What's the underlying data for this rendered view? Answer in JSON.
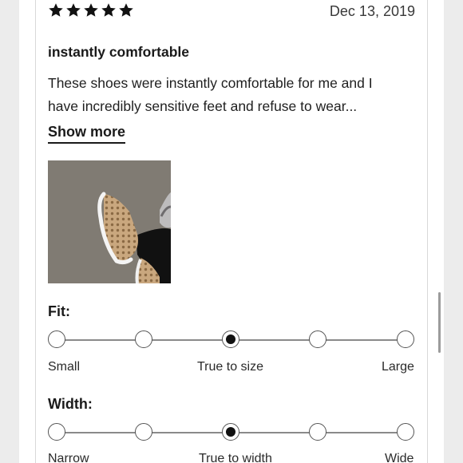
{
  "review": {
    "rating": 5,
    "rating_max": 5,
    "date": "Dec 13, 2019",
    "title": "instantly comfortable",
    "body_line1": "These shoes were instantly comfortable for me and I",
    "body_line2": "have incredibly sensitive feet and refuse to wear...",
    "show_more_label": "Show more"
  },
  "fit": {
    "label": "Fit:",
    "options": 5,
    "selected_index": 2,
    "left_label": "Small",
    "center_label": "True to size",
    "right_label": "Large"
  },
  "width": {
    "label": "Width:",
    "options": 5,
    "selected_index": 2,
    "left_label": "Narrow",
    "center_label": "True to width",
    "right_label": "Wide"
  },
  "icons": {
    "star": "star-icon"
  },
  "colors": {
    "star": "#111111",
    "text": "#1a1a1a",
    "card_border": "#d9d9d9",
    "scrollbar": "#9c9c9c"
  }
}
